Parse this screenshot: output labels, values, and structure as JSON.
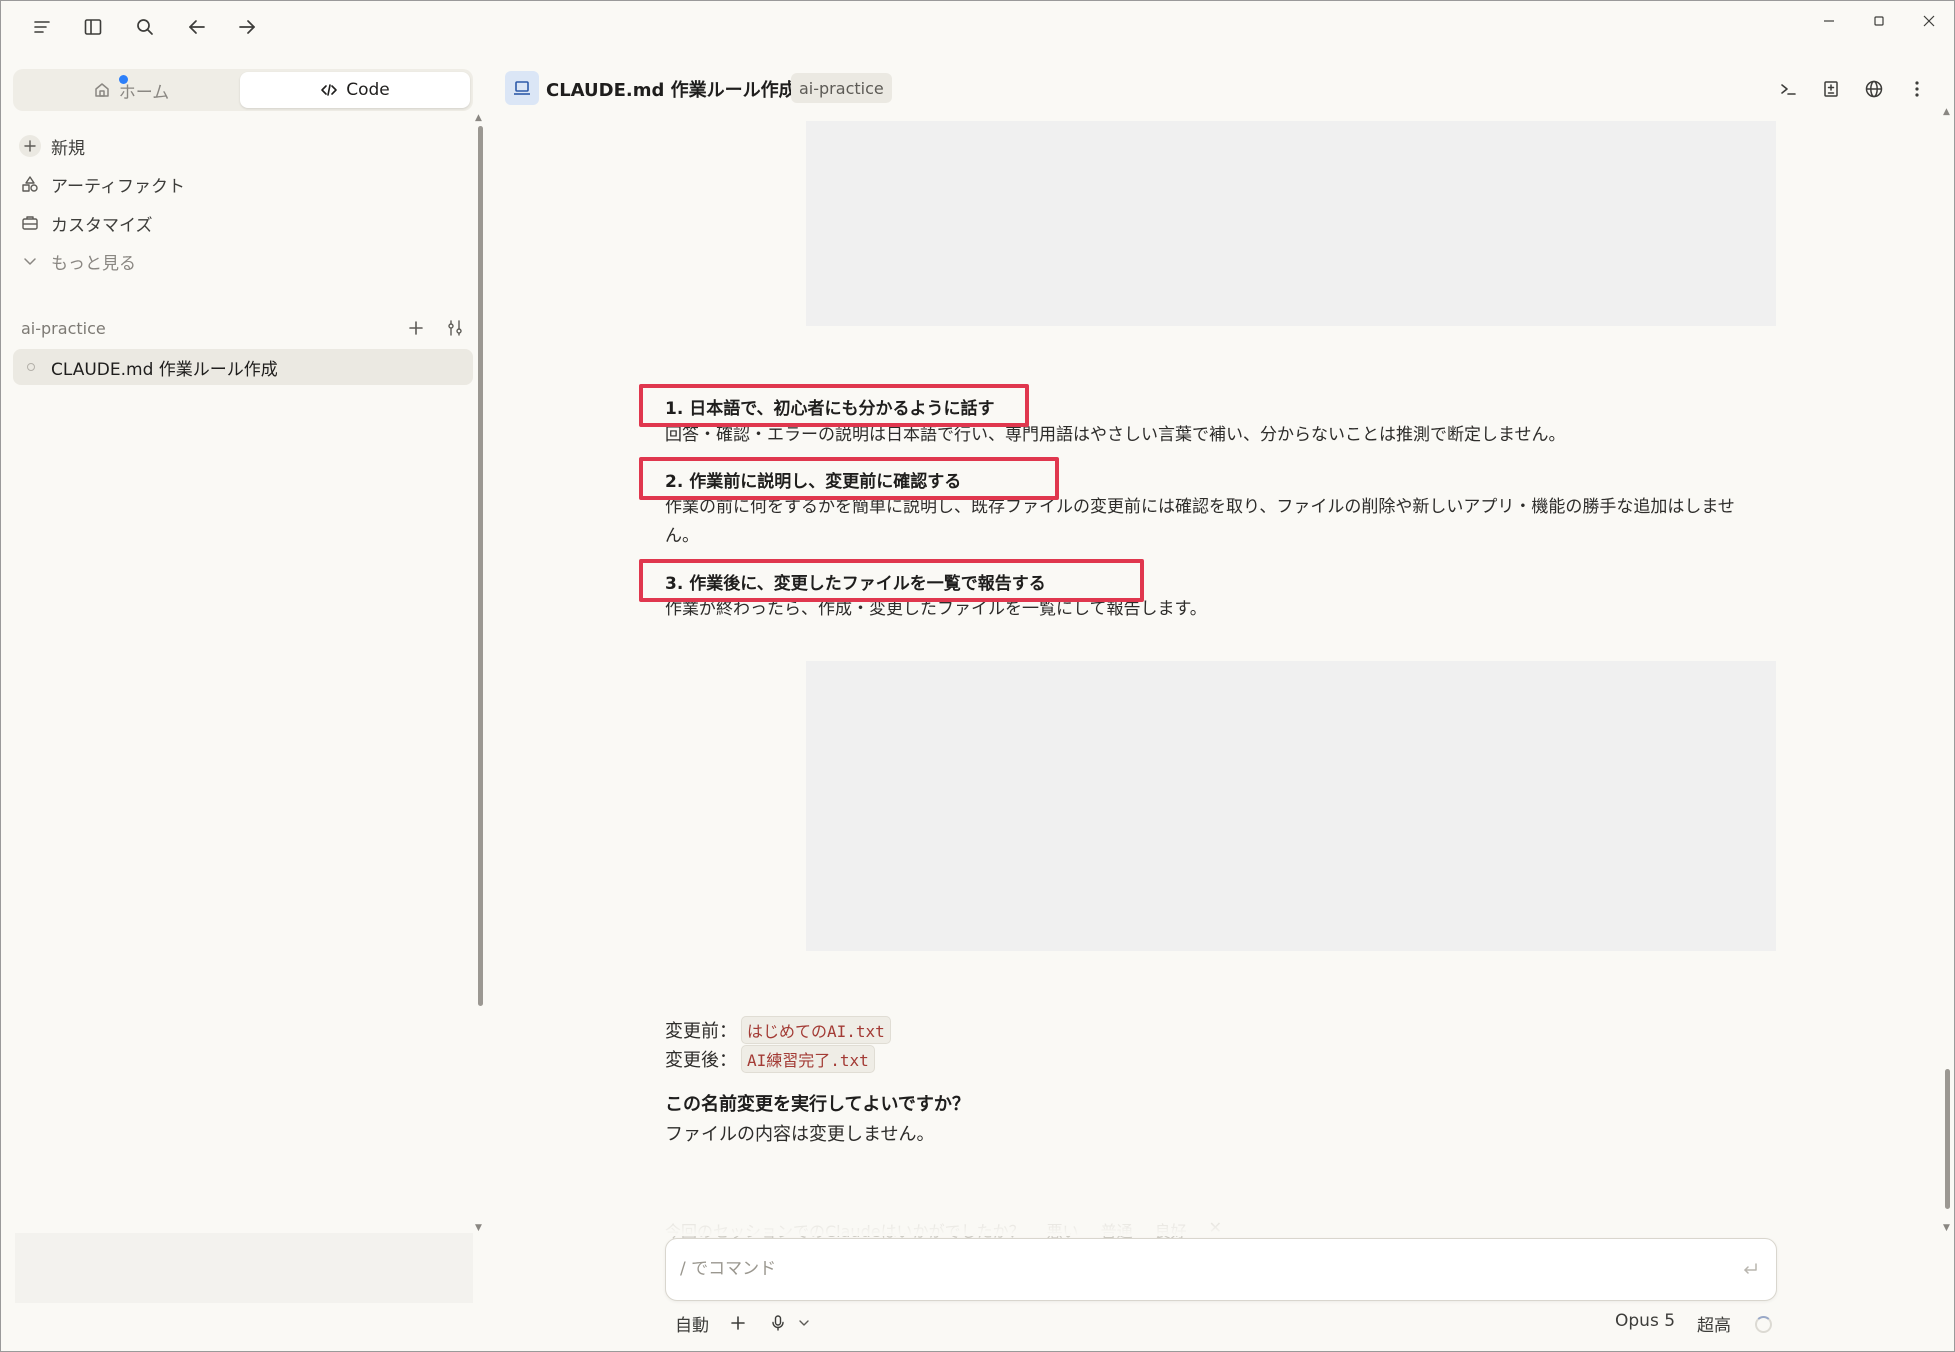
{
  "sidebar": {
    "tabs": {
      "home": "ホーム",
      "code": "Code"
    },
    "nav": {
      "new": "新規",
      "artifacts": "アーティファクト",
      "customize": "カスタマイズ",
      "more": "もっと見る"
    },
    "project": {
      "name": "ai-practice",
      "sessions": [
        "CLAUDE.md 作業ルール作成"
      ]
    }
  },
  "header": {
    "title": "CLAUDE.md 作業ルール作成",
    "badge": "ai-practice"
  },
  "chat": {
    "rules": [
      {
        "title": "1. 日本語で、初心者にも分かるように話す",
        "desc": "回答・確認・エラーの説明は日本語で行い、専門用語はやさしい言葉で補い、分からないことは推測で断定しません。"
      },
      {
        "title": "2. 作業前に説明し、変更前に確認する",
        "desc": "作業の前に何をするかを簡単に説明し、既存ファイルの変更前には確認を取り、ファイルの削除や新しいアプリ・機能の勝手な追加はしません。"
      },
      {
        "title": "3. 作業後に、変更したファイルを一覧で報告する",
        "desc": "作業が終わったら、作成・変更したファイルを一覧にして報告します。"
      }
    ],
    "rename": {
      "before_label": "変更前：",
      "before_file": "はじめてのAI.txt",
      "after_label": "変更後：",
      "after_file": "AI練習完了.txt"
    },
    "question": "この名前変更を実行してよいですか？",
    "question_sub": "ファイルの内容は変更しません。",
    "feedback": {
      "prompt": "今回のセッションでのClaudeはいかがでしたか？",
      "bad": "悪い",
      "ok": "普通",
      "good": "良好"
    }
  },
  "composer": {
    "placeholder": "/ でコマンド",
    "mode": "自動",
    "model": "Opus 5",
    "effort": "超高"
  },
  "colors": {
    "accent": "#e0374e",
    "background": "#faf9f5",
    "notification_dot": "#2d7ff9"
  }
}
